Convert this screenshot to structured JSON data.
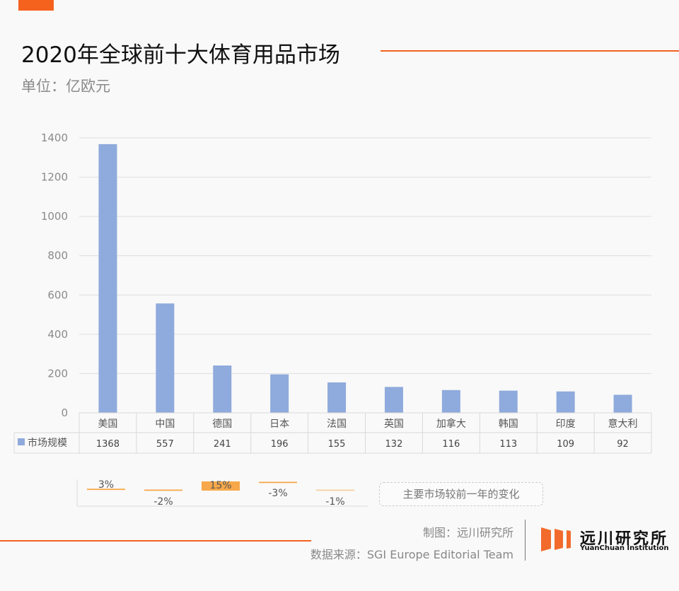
{
  "header": {
    "title": "2020年全球前十大体育用品市场",
    "unit": "单位：亿欧元"
  },
  "chart_data": [
    {
      "type": "bar",
      "title": "2020年全球前十大体育用品市场",
      "ylabel": "亿欧元",
      "xlabel": "",
      "categories": [
        "美国",
        "中国",
        "德国",
        "日本",
        "法国",
        "英国",
        "加拿大",
        "韩国",
        "印度",
        "意大利"
      ],
      "series": [
        {
          "name": "市场规模",
          "values": [
            1368,
            557,
            241,
            196,
            155,
            132,
            116,
            113,
            109,
            92
          ],
          "color": "#8faadc"
        }
      ],
      "ylim": [
        0,
        1400
      ],
      "yticks": [
        0,
        200,
        400,
        600,
        800,
        1000,
        1200,
        1400
      ],
      "grid": true,
      "data_table": true
    },
    {
      "type": "bar",
      "title": "主要市场较前一年的变化",
      "categories": [
        "美国",
        "中国",
        "德国",
        "日本",
        "法国"
      ],
      "values": [
        3,
        -2,
        15,
        -3,
        -1
      ],
      "labels": [
        "3%",
        "-2%",
        "15%",
        "-3%",
        "-1%"
      ],
      "unit": "%",
      "color": "#f7a84a"
    }
  ],
  "change_label": "主要市场较前一年的变化",
  "footer": {
    "credit": "制图：远川研究所",
    "source": "数据来源：SGI Europe Editorial Team",
    "logo_cn": "远川研究所",
    "logo_en": "YuanChuan Institution"
  },
  "colors": {
    "accent": "#f5621e",
    "bar": "#8faadc",
    "change": "#f7a84a"
  }
}
